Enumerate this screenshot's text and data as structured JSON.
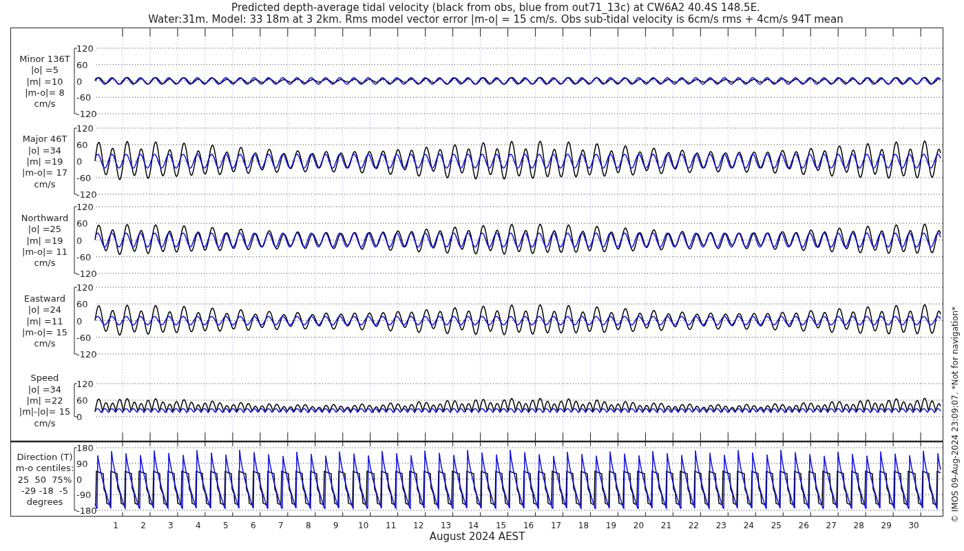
{
  "title_lines": [
    "Predicted depth-average tidal velocity (black from obs, blue from out71_13c) at CW6A2 40.4S 148.5E.",
    "Water:31m. Model: 33 18m at 3 2km. Rms model vector error |m-o| = 15 cm/s. Obs sub-tidal velocity is 6cm/s rms + 4cm/s 94T mean"
  ],
  "panels": [
    {
      "kind": "component",
      "label_lines": [
        "Minor 136T",
        "|o| =5",
        "|m| =10",
        "|m-o|= 8",
        "cm/s"
      ],
      "yticks": [
        "120",
        "60",
        "0",
        "-60",
        "-120"
      ]
    },
    {
      "kind": "component",
      "label_lines": [
        "Major 46T",
        "|o| =34",
        "|m| =19",
        "|m-o|= 17",
        "cm/s"
      ],
      "yticks": [
        "120",
        "60",
        "0",
        "-60",
        "-120"
      ]
    },
    {
      "kind": "component",
      "label_lines": [
        "Northward",
        "|o| =25",
        "|m| =19",
        "|m-o|= 11",
        "cm/s"
      ],
      "yticks": [
        "120",
        "60",
        "0",
        "-60",
        "-120"
      ]
    },
    {
      "kind": "component",
      "label_lines": [
        "Eastward",
        "|o| =24",
        "|m| =11",
        "|m-o|= 15",
        "cm/s"
      ],
      "yticks": [
        "120",
        "60",
        "0",
        "-60",
        "-120"
      ]
    },
    {
      "kind": "speed",
      "label_lines": [
        "Speed",
        "|o| =34",
        "|m| =22",
        "|m|-|o|= 15",
        "cm/s"
      ],
      "yticks": [
        "120",
        "60",
        "0"
      ]
    },
    {
      "kind": "direction",
      "label_lines": [
        "Direction (T)",
        "m-o centiles:",
        "25  50  75%",
        "-29 -18  -5",
        "degrees"
      ],
      "yticks": [
        "180",
        "90",
        "0",
        "-90",
        "-180"
      ]
    }
  ],
  "x_axis": {
    "day_labels": [
      "1",
      "2",
      "3",
      "4",
      "5",
      "6",
      "7",
      "8",
      "9",
      "10",
      "11",
      "12",
      "13",
      "14",
      "15",
      "16",
      "17",
      "18",
      "19",
      "20",
      "21",
      "22",
      "23",
      "24",
      "25",
      "26",
      "27",
      "28",
      "29",
      "30"
    ],
    "xlabel": "August 2024 AEST"
  },
  "credit": "© IMOS 09-Aug-2024 23:09:07. *Not for navigation*"
}
